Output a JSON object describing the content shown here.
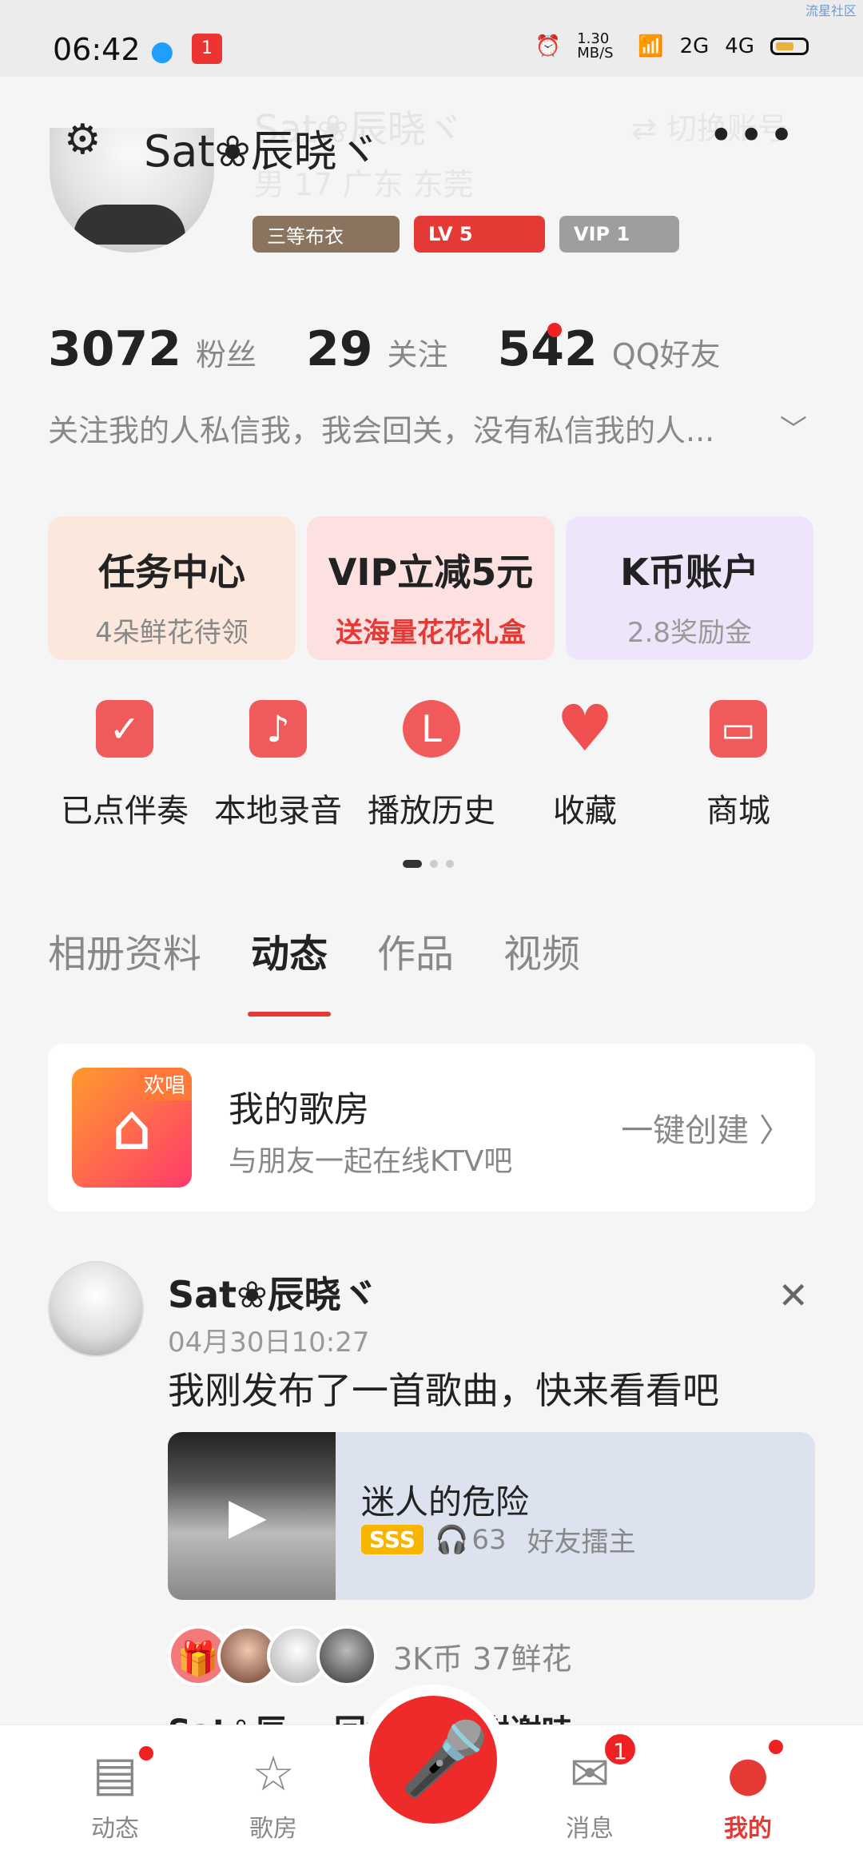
{
  "status_bar": {
    "time": "06:42",
    "net_speed": "1.30 MB/S",
    "signal_2g": "2G",
    "signal_4g": "4G",
    "app_badge": "1",
    "corner_text": "流星社区"
  },
  "profile": {
    "username": "Sat❀辰晓ヾ",
    "ghost_name": "Sat❀辰晓ヾ",
    "ghost_switch": "⇄ 切换账号",
    "ghost_sub": "男 17 广东 东莞",
    "badges": [
      "三等布衣",
      "LV 5",
      "VIP 1"
    ],
    "stats": {
      "fans_count": "3072",
      "fans_label": "粉丝",
      "follow_count": "29",
      "follow_label": "关注",
      "qq_count": "542",
      "qq_label": "QQ好友"
    },
    "bio": "关注我的人私信我，我会回关，没有私信我的人..."
  },
  "cards": [
    {
      "title": "任务中心",
      "sub": "4朵鲜花待领"
    },
    {
      "title": "VIP立减5元",
      "sub": "送海量花花礼盒"
    },
    {
      "title": "K币账户",
      "sub": "2.8奖励金"
    }
  ],
  "shortcuts": [
    {
      "label": "已点伴奏",
      "icon": "check-icon"
    },
    {
      "label": "本地录音",
      "icon": "music-note-icon"
    },
    {
      "label": "播放历史",
      "icon": "clock-icon"
    },
    {
      "label": "收藏",
      "icon": "heart-icon"
    },
    {
      "label": "商城",
      "icon": "store-icon"
    }
  ],
  "tabs": [
    "相册资料",
    "动态",
    "作品",
    "视频"
  ],
  "ktv": {
    "tag": "欢唱",
    "title": "我的歌房",
    "subtitle": "与朋友一起在线KTV吧",
    "action": "一键创建 〉"
  },
  "post": {
    "author": "Sat❀辰晓ヾ",
    "time": "04月30日10:27",
    "text": "我刚发布了一首歌曲，快来看看吧",
    "song_title": "迷人的危险",
    "grade": "SSS",
    "listens": "63",
    "tag": "好友擂主",
    "gift_summary": "3K币  37鲜花",
    "reply_peek": "Sat❀辰... 回复... ：谢谢哇"
  },
  "bottom_nav": [
    {
      "label": "动态"
    },
    {
      "label": "歌房"
    },
    {
      "label": "消息",
      "badge": "1"
    },
    {
      "label": "我的"
    }
  ]
}
